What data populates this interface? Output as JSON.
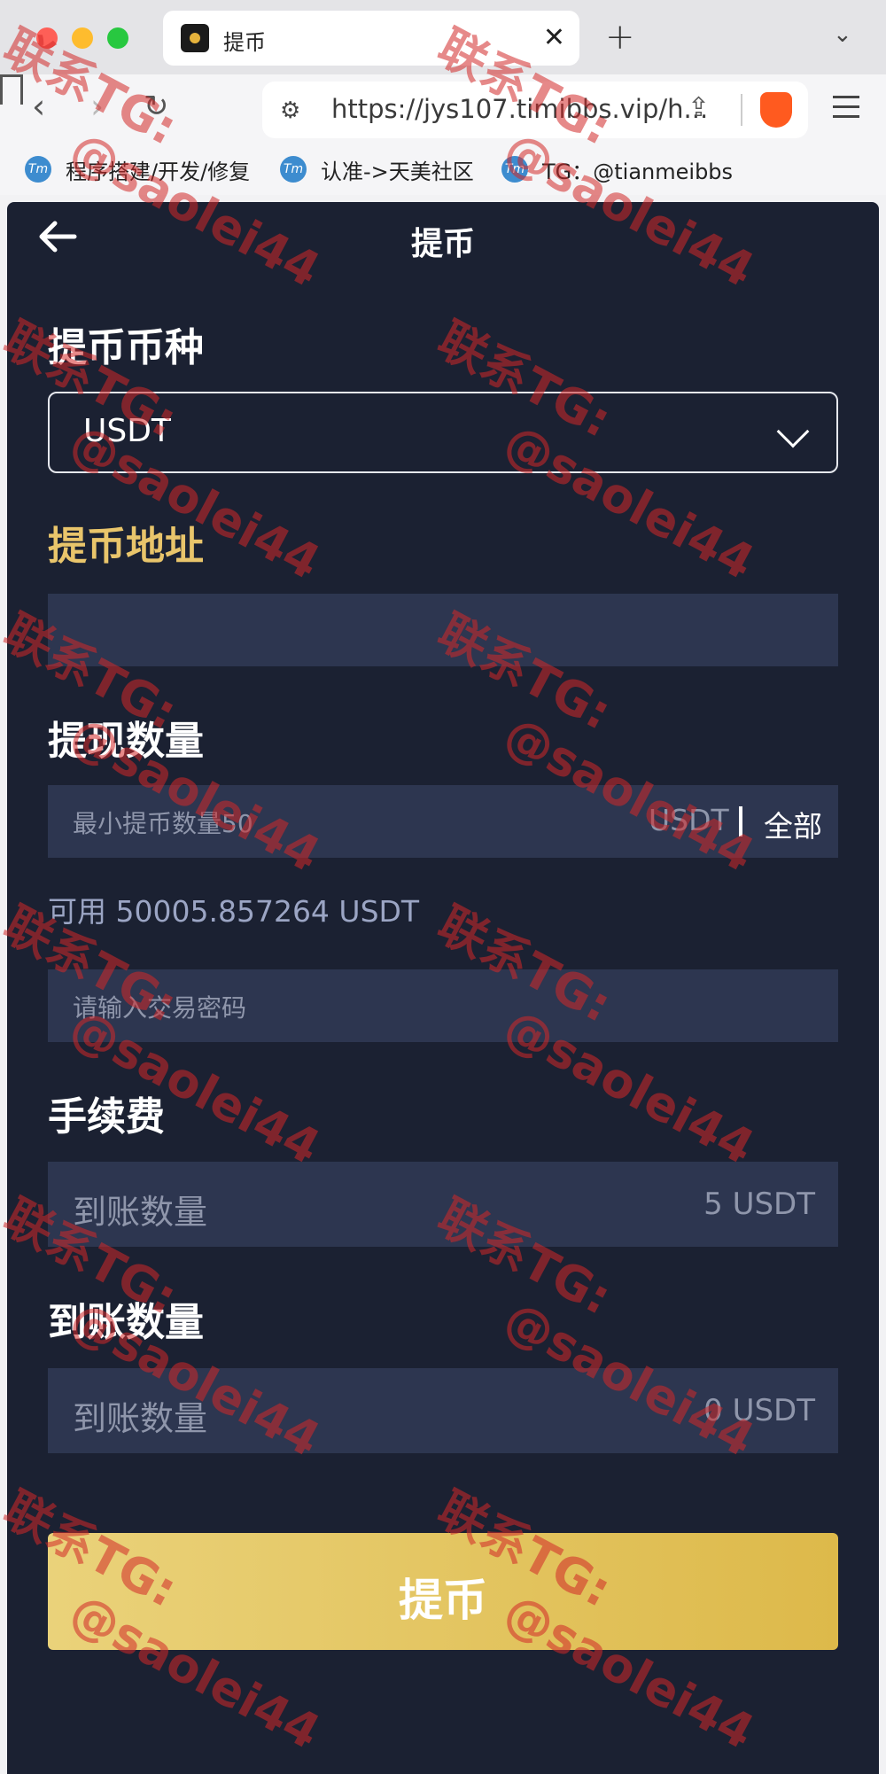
{
  "browser": {
    "tab_title": "提币",
    "url": "https://jys107.timibbs.vip/h...",
    "bookmarks": [
      {
        "label": "程序搭建/开发/修复"
      },
      {
        "label": "认准->天美社区"
      },
      {
        "label": "TG：@tianmeibbs"
      }
    ],
    "bookmark_icon_text": "Tm"
  },
  "page": {
    "title": "提币",
    "currency_label": "提币币种",
    "currency_value": "USDT",
    "address_label": "提币地址",
    "address_value": "",
    "amount_label": "提现数量",
    "amount_placeholder": "最小提币数量50",
    "amount_unit": "USDT",
    "all_label": "全部",
    "available_text": "可用 50005.857264 USDT",
    "password_placeholder": "请输入交易密码",
    "fee_label": "手续费",
    "fee_field_label": "到账数量",
    "fee_value": "5 USDT",
    "received_label": "到账数量",
    "received_field_label": "到账数量",
    "received_value": "0 USDT",
    "submit_label": "提币"
  },
  "watermark": {
    "line1": "联系TG:",
    "line2": "@saolei44"
  },
  "colors": {
    "app_bg": "#1b2132",
    "field_bg": "#2d3650",
    "gold": "#e9c56b",
    "button_gradient_start": "#ead27a",
    "button_gradient_end": "#ddb94a",
    "watermark": "#d22828"
  }
}
